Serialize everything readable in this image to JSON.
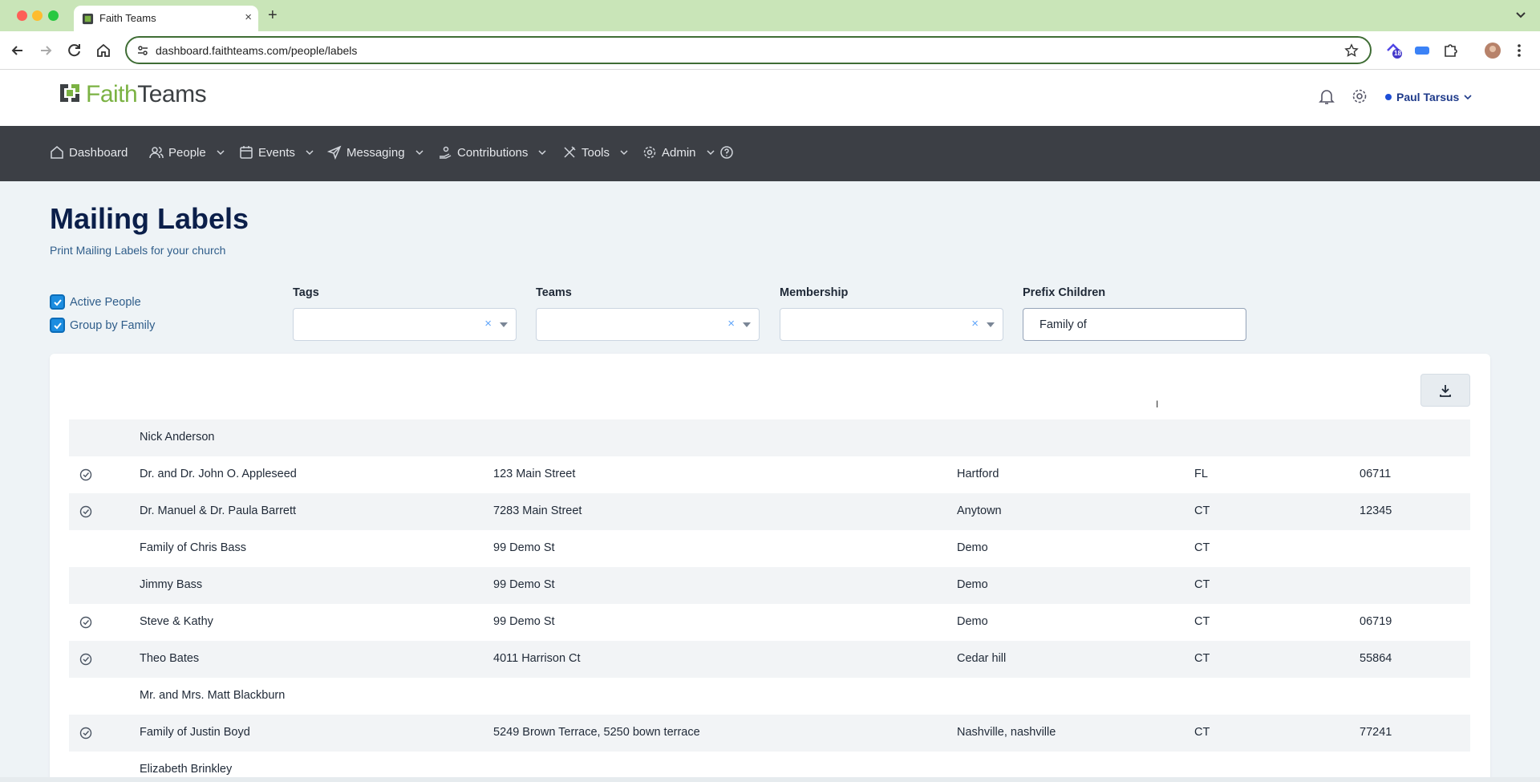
{
  "browser": {
    "tab_title": "Faith Teams",
    "url": "dashboard.faithteams.com/people/labels",
    "new_tab": "+",
    "tab_close": "×",
    "extension_badge": "18"
  },
  "header": {
    "brand_part1": "Faith",
    "brand_part2": "Teams",
    "user_name": "Paul Tarsus"
  },
  "nav": {
    "items": [
      {
        "label": "Dashboard",
        "icon": "home-icon"
      },
      {
        "label": "People",
        "icon": "people-icon"
      },
      {
        "label": "Events",
        "icon": "calendar-icon"
      },
      {
        "label": "Messaging",
        "icon": "send-icon"
      },
      {
        "label": "Contributions",
        "icon": "hand-coin-icon"
      },
      {
        "label": "Tools",
        "icon": "tools-icon"
      },
      {
        "label": "Admin",
        "icon": "gear-icon"
      }
    ]
  },
  "page": {
    "title": "Mailing Labels",
    "subtitle": "Print Mailing Labels for your church"
  },
  "filters": {
    "active_people": "Active People",
    "group_by_family": "Group by Family",
    "tags_label": "Tags",
    "teams_label": "Teams",
    "membership_label": "Membership",
    "prefix_label": "Prefix Children",
    "prefix_value": "Family of",
    "clear_glyph": "×"
  },
  "cursor_glyph": "I",
  "rows": [
    {
      "checked": false,
      "name": "Nick Anderson",
      "address": "",
      "city": "",
      "state": "",
      "zip": ""
    },
    {
      "checked": true,
      "name": "Dr. and Dr. John O. Appleseed",
      "address": "123 Main Street",
      "city": "Hartford",
      "state": "FL",
      "zip": "06711"
    },
    {
      "checked": true,
      "name": "Dr. Manuel & Dr. Paula Barrett",
      "address": "7283 Main Street",
      "city": "Anytown",
      "state": "CT",
      "zip": "12345"
    },
    {
      "checked": false,
      "name": "Family of Chris Bass",
      "address": "99 Demo St",
      "city": "Demo",
      "state": "CT",
      "zip": ""
    },
    {
      "checked": false,
      "name": "Jimmy Bass",
      "address": "99 Demo St",
      "city": "Demo",
      "state": "CT",
      "zip": ""
    },
    {
      "checked": true,
      "name": "Steve & Kathy",
      "address": "99 Demo St",
      "city": "Demo",
      "state": "CT",
      "zip": "06719"
    },
    {
      "checked": true,
      "name": "Theo Bates",
      "address": "4011 Harrison Ct",
      "city": "Cedar hill",
      "state": "CT",
      "zip": "55864"
    },
    {
      "checked": false,
      "name": "Mr. and Mrs. Matt Blackburn",
      "address": "",
      "city": "",
      "state": "",
      "zip": ""
    },
    {
      "checked": true,
      "name": "Family of Justin Boyd",
      "address": "5249 Brown Terrace, 5250 bown terrace",
      "city": "Nashville, nashville",
      "state": "CT",
      "zip": "77241"
    },
    {
      "checked": false,
      "name": "Elizabeth Brinkley",
      "address": "",
      "city": "",
      "state": "",
      "zip": ""
    }
  ]
}
